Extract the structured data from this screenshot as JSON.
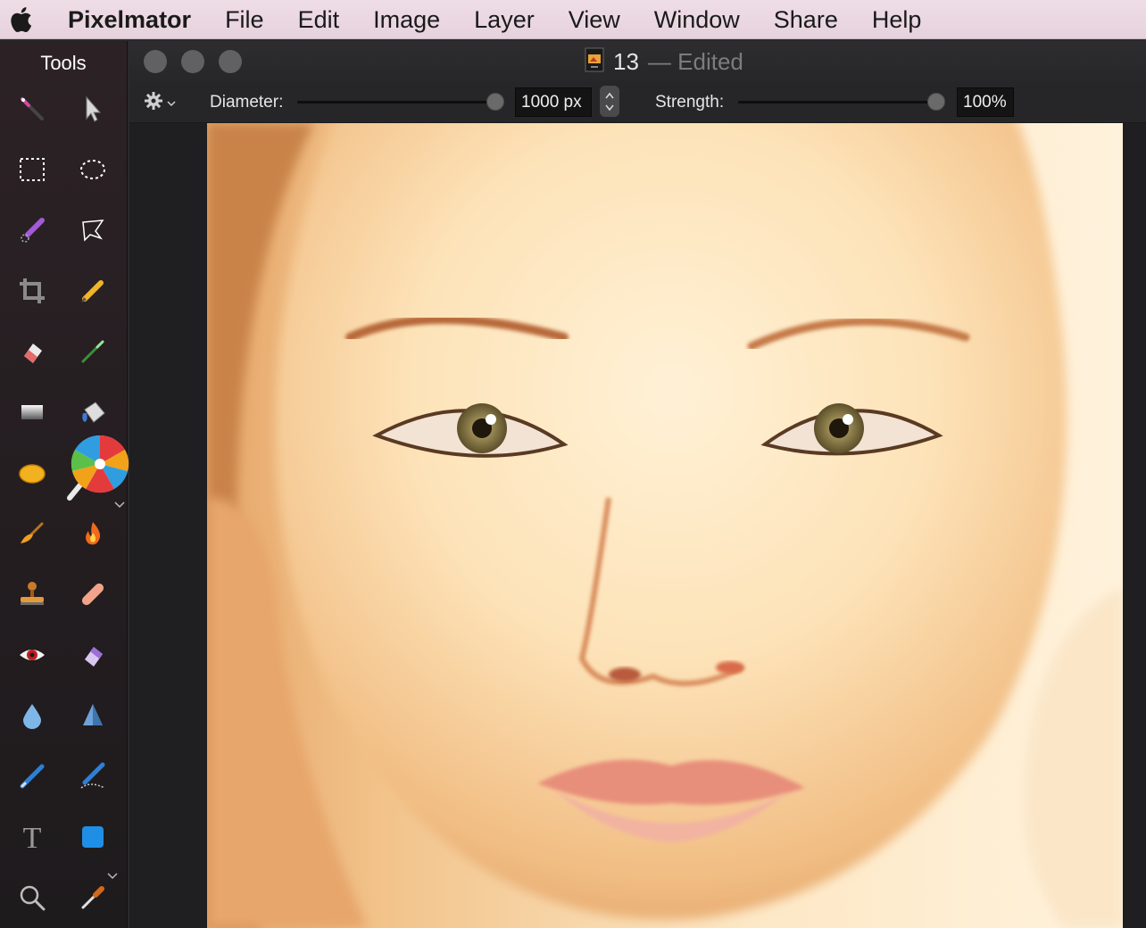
{
  "menubar": {
    "app_name": "Pixelmator",
    "items": [
      "File",
      "Edit",
      "Image",
      "Layer",
      "View",
      "Window",
      "Share",
      "Help"
    ]
  },
  "tools_panel": {
    "title": "Tools"
  },
  "document": {
    "number": "13",
    "status": "— Edited"
  },
  "options": {
    "diameter_label": "Diameter:",
    "diameter_value": "1000 px",
    "strength_label": "Strength:",
    "strength_value": "100%"
  },
  "icons": {
    "apple": "apple-logo-icon",
    "gear": "gear-icon",
    "document": "pxm-document-icon"
  }
}
